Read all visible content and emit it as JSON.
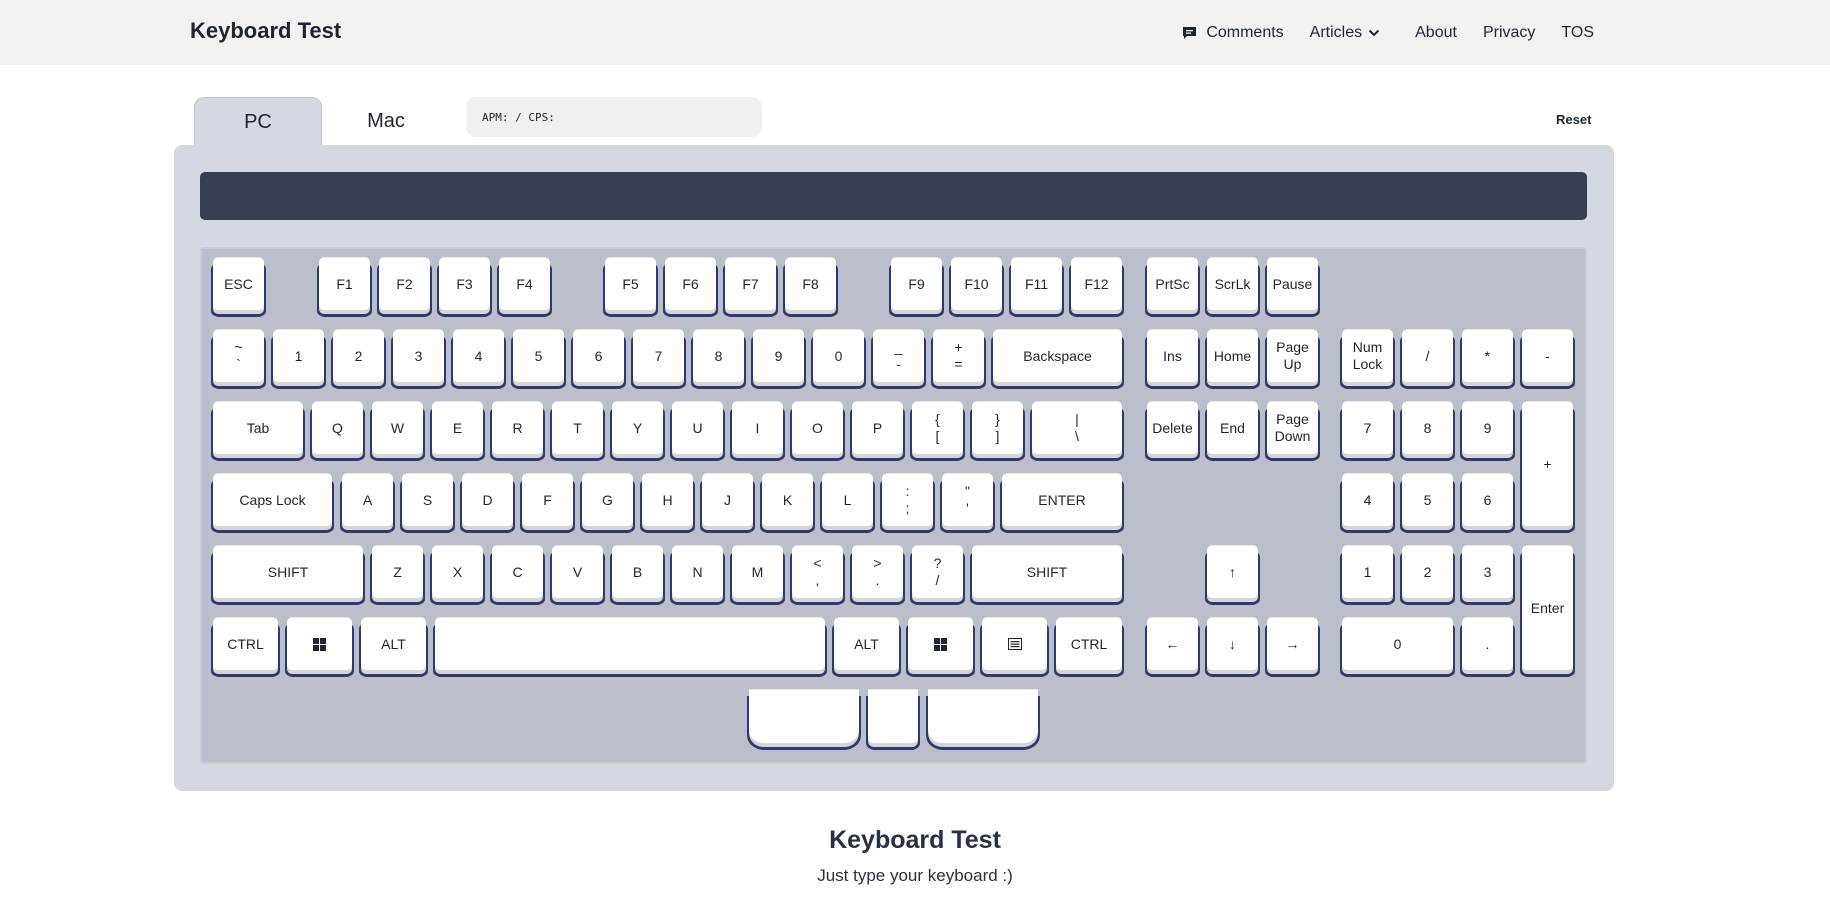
{
  "brand": "Keyboard Test",
  "nav": {
    "comments": "Comments",
    "articles": "Articles",
    "about": "About",
    "privacy": "Privacy",
    "tos": "TOS"
  },
  "tabs": {
    "pc": "PC",
    "mac": "Mac"
  },
  "apm_label": "APM:  / CPS:",
  "reset_label": "Reset",
  "keys": {
    "esc": "ESC",
    "f1": "F1",
    "f2": "F2",
    "f3": "F3",
    "f4": "F4",
    "f5": "F5",
    "f6": "F6",
    "f7": "F7",
    "f8": "F8",
    "f9": "F9",
    "f10": "F10",
    "f11": "F11",
    "f12": "F12",
    "prtsc": "PrtSc",
    "scrlk": "ScrLk",
    "pause": "Pause",
    "tilde_top": "~",
    "tilde_bot": "`",
    "d1": "1",
    "d2": "2",
    "d3": "3",
    "d4": "4",
    "d5": "5",
    "d6": "6",
    "d7": "7",
    "d8": "8",
    "d9": "9",
    "d0": "0",
    "minus_top": "_",
    "minus_bot": "-",
    "equal_top": "+",
    "equal_bot": "=",
    "backspace": "Backspace",
    "ins": "Ins",
    "home": "Home",
    "pageup_1": "Page",
    "pageup_2": "Up",
    "numlock_1": "Num",
    "numlock_2": "Lock",
    "np_div": "/",
    "np_mul": "*",
    "np_sub": "-",
    "tab": "Tab",
    "q": "Q",
    "w": "W",
    "e": "E",
    "r": "R",
    "t": "T",
    "y": "Y",
    "u": "U",
    "i": "I",
    "o": "O",
    "p": "P",
    "lbr_top": "{",
    "lbr_bot": "[",
    "rbr_top": "}",
    "rbr_bot": "]",
    "bs_top": "|",
    "bs_bot": "\\",
    "delete": "Delete",
    "end": "End",
    "pagedown_1": "Page",
    "pagedown_2": "Down",
    "np7": "7",
    "np8": "8",
    "np9": "9",
    "np_add": "+",
    "capslock": "Caps Lock",
    "a": "A",
    "s": "S",
    "d": "D",
    "f": "F",
    "g": "G",
    "h": "H",
    "j": "J",
    "k": "K",
    "l": "L",
    "semi_top": ":",
    "semi_bot": ";",
    "quote_top": "\"",
    "quote_bot": "'",
    "enter": "ENTER",
    "np4": "4",
    "np5": "5",
    "np6": "6",
    "lshift": "SHIFT",
    "z": "Z",
    "x": "X",
    "c": "C",
    "v": "V",
    "b": "B",
    "n": "N",
    "m": "M",
    "comma_top": "<",
    "comma_bot": ",",
    "period_top": ">",
    "period_bot": ".",
    "slash_top": "?",
    "slash_bot": "/",
    "rshift": "SHIFT",
    "up": "↑",
    "np1": "1",
    "np2": "2",
    "np3": "3",
    "np_enter": "Enter",
    "lctrl": "CTRL",
    "lalt": "ALT",
    "ralt": "ALT",
    "rctrl": "CTRL",
    "left": "←",
    "down": "↓",
    "right": "→",
    "np0": "0",
    "np_dot": "."
  },
  "footer": {
    "title": "Keyboard Test",
    "subtitle": "Just type your keyboard :)"
  }
}
